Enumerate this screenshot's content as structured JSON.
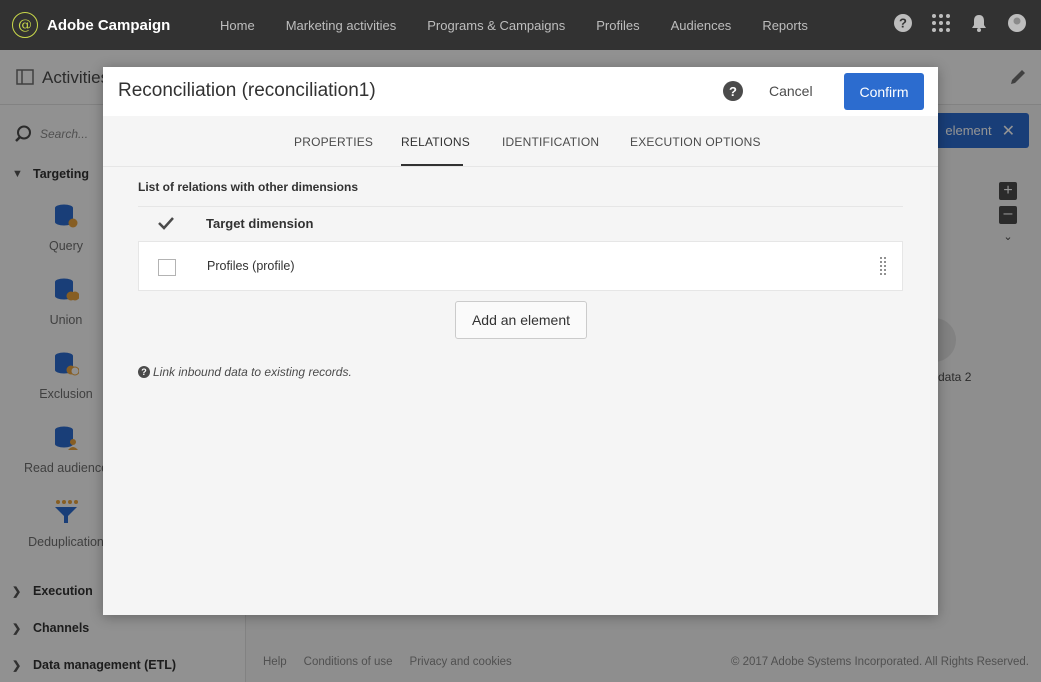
{
  "topbar": {
    "product": "Adobe Campaign",
    "nav": [
      "Home",
      "Marketing activities",
      "Programs & Campaigns",
      "Profiles",
      "Audiences",
      "Reports"
    ]
  },
  "page": {
    "title": "Activities"
  },
  "sidebar": {
    "search_placeholder": "Search...",
    "sections": [
      "Targeting",
      "Execution",
      "Channels",
      "Data management (ETL)"
    ],
    "activities": [
      "Query",
      "Union",
      "Exclusion",
      "Read audience",
      "Deduplication"
    ]
  },
  "canvas": {
    "add_element": "element",
    "node_label": "data 2"
  },
  "footer": {
    "links": [
      "Help",
      "Conditions of use",
      "Privacy and cookies"
    ],
    "copyright": "© 2017 Adobe Systems Incorporated. All Rights Reserved."
  },
  "dialog": {
    "title": "Reconciliation (reconciliation1)",
    "cancel": "Cancel",
    "confirm": "Confirm",
    "tabs": [
      "PROPERTIES",
      "RELATIONS",
      "IDENTIFICATION",
      "EXECUTION OPTIONS"
    ],
    "active_tab": "RELATIONS",
    "list_title": "List of relations with other dimensions",
    "column_header": "Target dimension",
    "rows": [
      {
        "label": "Profiles (profile)",
        "checked": false
      }
    ],
    "add_button": "Add an element",
    "info": "Link inbound data to existing records."
  },
  "colors": {
    "accent": "#2c6ccf",
    "topbar": "#323232",
    "logo": "#c9d84a"
  }
}
